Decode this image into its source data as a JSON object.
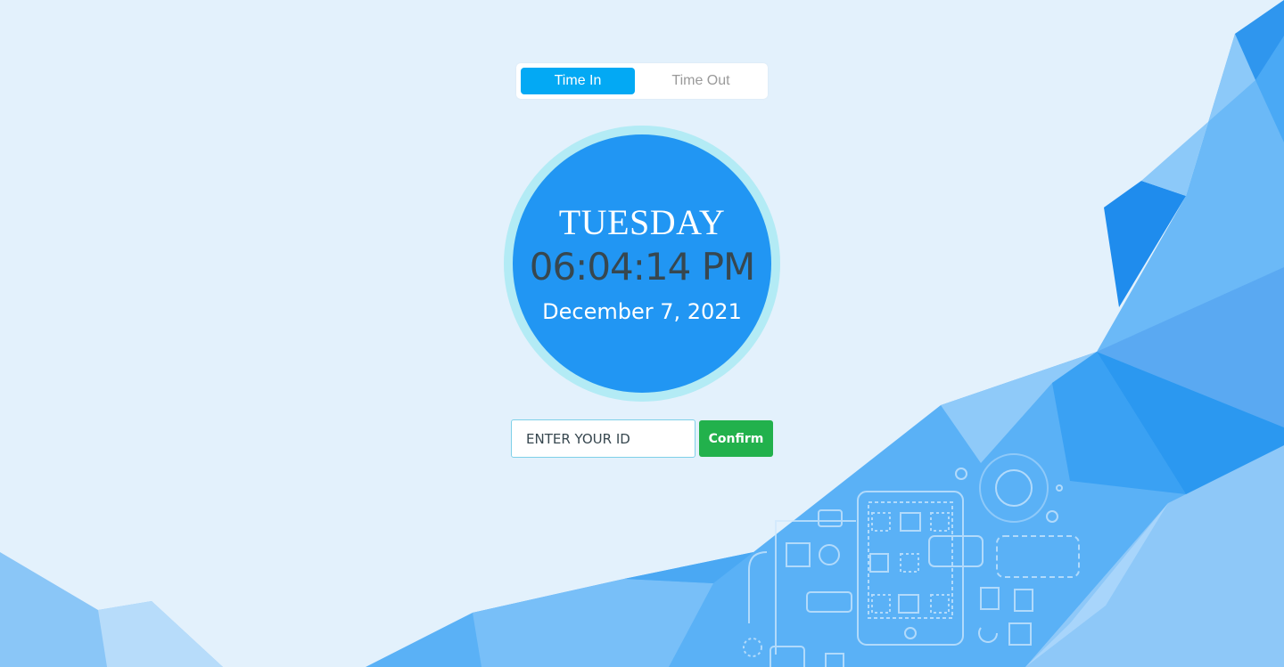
{
  "tabs": {
    "time_in": "Time In",
    "time_out": "Time Out",
    "active": "time_in"
  },
  "clock": {
    "day": "TUESDAY",
    "time": "06:04:14 PM",
    "date": "December 7, 2021"
  },
  "form": {
    "id_placeholder": "ENTER YOUR ID",
    "id_value": "",
    "confirm_label": "Confirm"
  },
  "colors": {
    "accent": "#03a9f4",
    "clock_face": "#2196f3",
    "clock_ring": "#b3ebf5",
    "confirm": "#22b14c",
    "background": "#e3f1fc"
  }
}
